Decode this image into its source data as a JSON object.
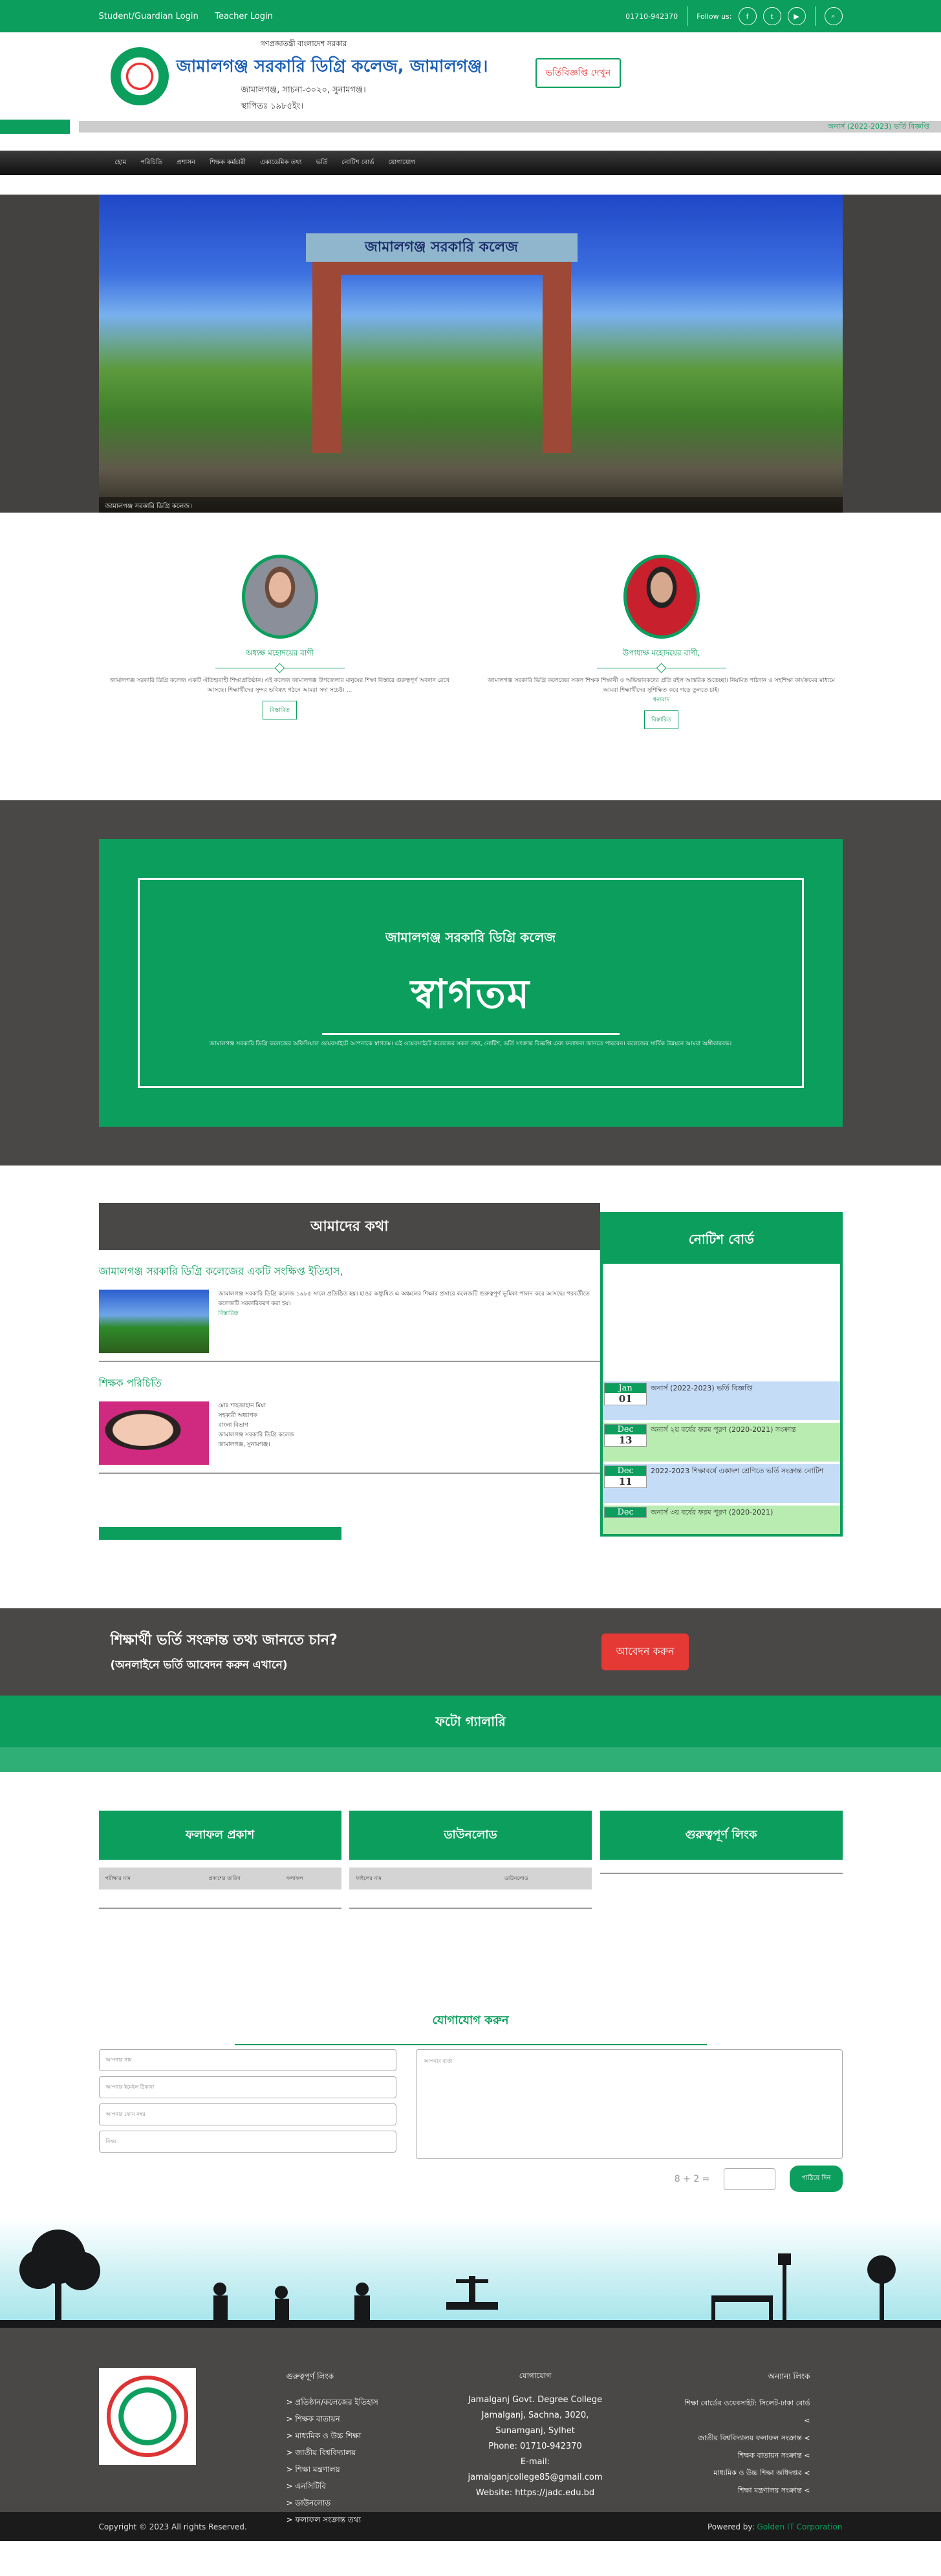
{
  "topbar": {
    "student_login": " Student/Guardian Login",
    "teacher_login": " Teacher Login",
    "phone": " 01710-942370",
    "follow": "Follow us:"
  },
  "header": {
    "gov": "গণপ্রজাতন্ত্রী বাংলাদেশ সরকার",
    "college_name": "জামালগঞ্জ সরকারি ডিগ্রি কলেজ, জামালগঞ্জ।",
    "address": "জামালগঞ্জ, সাচনা-৩০২০, সুনামগঞ্জ।",
    "established": "স্থাপিতঃ ১৯৮৫ইং।",
    "admission_button": " ভর্তিবিজ্ঞপ্তি দেখুন"
  },
  "ticker": {
    "text": " অনার্স (2022-2023) ভর্তি বিজ্ঞপ্তি"
  },
  "nav": [
    "হোম",
    "পরিচিতি",
    "প্রশাসন",
    "শিক্ষক কর্মচারী",
    "একাডেমিক তথ্য",
    "ভর্তি",
    "নোটিশ বোর্ড",
    "যোগাযোগ"
  ],
  "hero": {
    "sign": "জামালগঞ্জ সরকারি কলেজ",
    "caption": "জামালগঞ্জ সরকারি ডিগ্রি কলেজ।"
  },
  "leaders": [
    {
      "name": "অধ্যক্ষ মহোদয়ের বাণী",
      "text": "জামালগঞ্জ সরকারি ডিগ্রি কলেজ একটি ঐতিহ্যবাহী শিক্ষাপ্রতিষ্ঠান। এই কলেজ জামালগঞ্জ উপজেলার মানুষের শিক্ষা বিস্তারে গুরুত্বপূর্ণ অবদান রেখে আসছে। শিক্ষার্থীদের সুন্দর ভবিষ্যৎ গঠনে আমরা সদা সচেষ্ট। ...",
      "more": "বিস্তারিত "
    },
    {
      "name": "উপাধ্যক্ষ মহোদয়ের বাণী,",
      "text": "জামালগঞ্জ সরকারি ডিগ্রি কলেজের সকল শিক্ষক শিক্ষার্থী ও অভিভাবকদের প্রতি রইল আন্তরিক শুভেচ্ছা। নিয়মিত পাঠদান ও সহশিক্ষা কার্যক্রমের মাধ্যমে আমরা শিক্ষার্থীদের সুশিক্ষিত করে গড়ে তুলতে চাই।",
      "tail": "ধন্যবাদ",
      "more": "বিস্তারিত "
    }
  ],
  "welcome": {
    "heading": "জামালগঞ্জ সরকারি ডিগ্রি কলেজ",
    "big": "স্বাগতম",
    "dot": "",
    "text": "জামালগঞ্জ সরকারি ডিগ্রি কলেজের অফিসিয়াল ওয়েবসাইটে আপনাকে স্বাগতম। এই ওয়েবসাইটে কলেজের সকল তথ্য, নোটিশ, ভর্তি সংক্রান্ত বিজ্ঞপ্তি এবং ফলাফল জানতে পারবেন। কলেজের সার্বিক উন্নয়নে আমরা অঙ্গীকারবদ্ধ।"
  },
  "news": {
    "title": "আমাদের কথা",
    "items": [
      {
        "title": "জামালগঞ্জ সরকারি ডিগ্রি কলেজের একটি সংক্ষিপ্ত ইতিহাস,",
        "text": "জামালগঞ্জ সরকারি ডিগ্রি কলেজ ১৯৮৫ সালে প্রতিষ্ঠিত হয়। হাওর অধ্যুষিত এ অঞ্চলের শিক্ষার প্রসারে কলেজটি গুরুত্বপূর্ণ ভূমিকা পালন করে আসছে। পরবর্তীতে কলেজটি সরকারিকরণ করা হয়।",
        "more": "বিস্তারিত "
      },
      {
        "title": "শিক্ষক পরিচিতি",
        "lines": [
          "মোঃ শাহজাহান মিয়া",
          "সহকারী অধ্যাপক",
          "বাংলা বিভাগ",
          "জামালগঞ্জ সরকারি ডিগ্রি কলেজ",
          "জামালগঞ্জ, সুনামগঞ্জ।"
        ]
      }
    ],
    "notice_title": "নোটিশ বোর্ড",
    "notices": [
      {
        "mon": "Jan",
        "day": "01",
        "text": "অনার্স (2022-2023) ভর্তি বিজ্ঞপ্তি",
        "c": "b"
      },
      {
        "mon": "Dec",
        "day": "13",
        "text": "অনার্স ২য় বর্ষের ফরম পূরণ (2020-2021) সংক্রান্ত",
        "c": "g"
      },
      {
        "mon": "Dec",
        "day": "11",
        "text": "2022-2023 শিক্ষাবর্ষে একাদশ শ্রেণিতে ভর্তি সংক্রান্ত নোটিশ",
        "c": "b"
      },
      {
        "mon": "Dec",
        "day": "",
        "text": "অনার্স ৩য় বর্ষের ফরম পূরণ (2020-2021)",
        "c": "g"
      }
    ]
  },
  "cta": {
    "h3": "শিক্ষার্থী ভর্তি সংক্রান্ত তথ্য জানতে চান?",
    "h4": "(অনলাইনে ভর্তি আবেদন করুন এখানে)",
    "btn": "আবেদন করুন"
  },
  "gallery": {
    "title": "ফটো গ্যালারি"
  },
  "tables": [
    {
      "title": "ফলাফল প্রকাশ",
      "h": [
        "পরীক্ষার নাম",
        "প্রকাশের তারিখ",
        "ফলাফল"
      ]
    },
    {
      "title": "ডাউনলোড",
      "h": [
        "ফাইলের নাম",
        "ডাউনলোড"
      ]
    },
    {
      "title": "গুরুত্বপূর্ণ লিংক",
      "h": []
    }
  ],
  "contact": {
    "title": "যোগাযোগ করুন",
    "dot": "",
    "name": "আপনার নাম",
    "email": "আপনার ইমেইল ঠিকানা",
    "phone": "আপনার ফোন নম্বর",
    "subject": "বিষয়",
    "message": "আপনার বার্তা",
    "captcha": "8 + 2 =",
    "send": "পাঠিয়ে দিন"
  },
  "footer": {
    "col1_title": "গুরুত্বপূর্ণ লিংক",
    "links": [
      "> প্রতিষ্ঠান/কলেজের ইতিহাস",
      "> শিক্ষক বাতায়ন",
      "> মাধ্যমিক ও উচ্চ শিক্ষা",
      "> জাতীয় বিশ্ববিদ্যালয়",
      "> শিক্ষা মন্ত্রণালয়",
      "> এনসিটিবি",
      "> ডাউনলোড",
      "> ফলাফল সংক্রান্ত তথ্য"
    ],
    "col2_title": "যোগাযোগ",
    "col2": [
      "Jamalganj Govt. Degree College",
      "Jamalganj, Sachna, 3020,",
      "Sunamganj, Sylhet",
      "Phone: 01710-942370",
      "E-mail:",
      "jamalganjcollege85@gmail.com",
      "Website: https://jadc.edu.bd"
    ],
    "col3_title": "অন্যান্য লিংক",
    "col3": [
      "শিক্ষা বোর্ডের ওয়েবসাইট: সিলেট-ঢাকা বোর্ড",
      "<",
      "জাতীয় বিশ্ববিদ্যালয় ফলাফল সংক্রান্ত <",
      "শিক্ষক বাতায়ন সংক্রান্ত <",
      "মাধ্যমিক ও উচ্চ শিক্ষা অধিদপ্তর <",
      "শিক্ষা মন্ত্রণালয় সংক্রান্ত <"
    ]
  },
  "bottom": {
    "copy": "Copyright © 2023 All rights Reserved.",
    "powered": "Powered by:",
    "company": "Golden IT Corporation"
  }
}
